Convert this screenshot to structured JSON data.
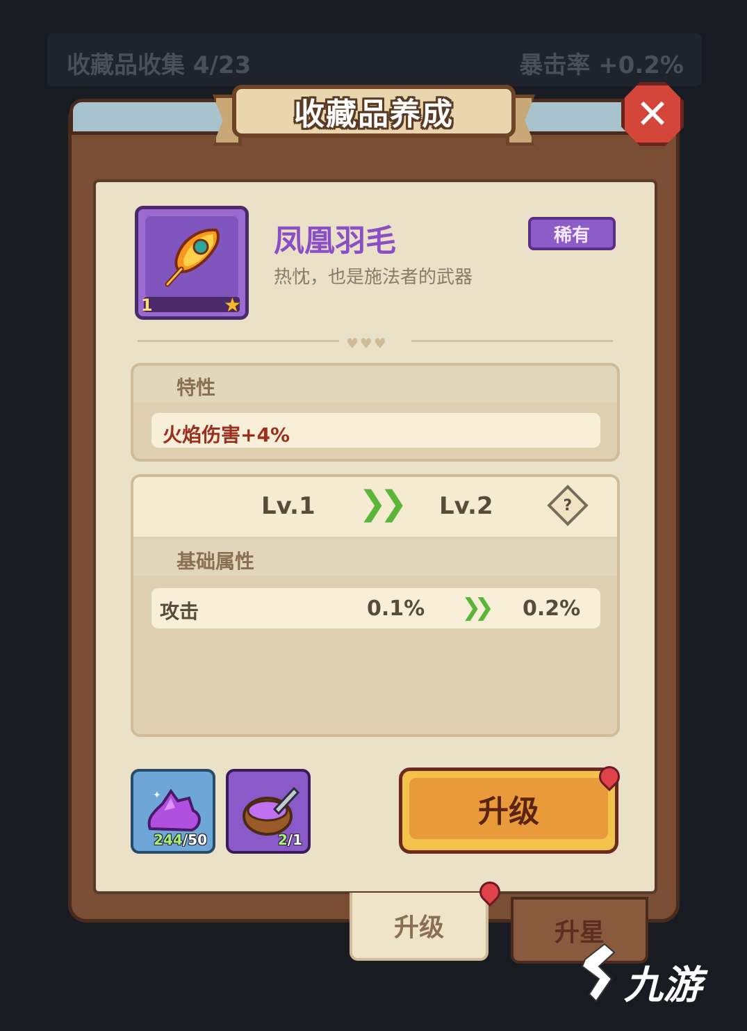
{
  "top_bar": {
    "collection_label": "收藏品收集 4/23",
    "crit_label": "暴击率 +0.2%"
  },
  "panel": {
    "title": "收藏品养成",
    "close_icon": "close-icon"
  },
  "item": {
    "level": "1",
    "icon": "phoenix-feather-icon",
    "name": "凤凰羽毛",
    "description": "热忱，也是施法者的武器",
    "rarity": "稀有"
  },
  "traits": {
    "title": "特性",
    "value": "火焰伤害+4%"
  },
  "level_compare": {
    "from": "Lv.1",
    "to": "Lv.2",
    "help_label": "?"
  },
  "base_stats": {
    "title": "基础属性",
    "rows": [
      {
        "name": "攻击",
        "from": "0.1%",
        "to": "0.2%"
      }
    ]
  },
  "materials": [
    {
      "icon": "purple-crystal-icon",
      "have": "244",
      "need": "/50"
    },
    {
      "icon": "coconut-potion-icon",
      "have": "2",
      "need": "/1"
    }
  ],
  "upgrade_button": {
    "label": "升级"
  },
  "tabs": [
    {
      "label": "升级",
      "active": true
    },
    {
      "label": "升星",
      "active": false
    }
  ],
  "watermark": {
    "text": "九游"
  },
  "colors": {
    "background": "#181b22",
    "wood": "#7a4d35",
    "paper": "#ebe1c9",
    "rarity_purple": "#8c5dc7",
    "accent_orange": "#e99a3a",
    "arrow_green": "#5bb53a",
    "trait_red": "#9c2e1f"
  }
}
